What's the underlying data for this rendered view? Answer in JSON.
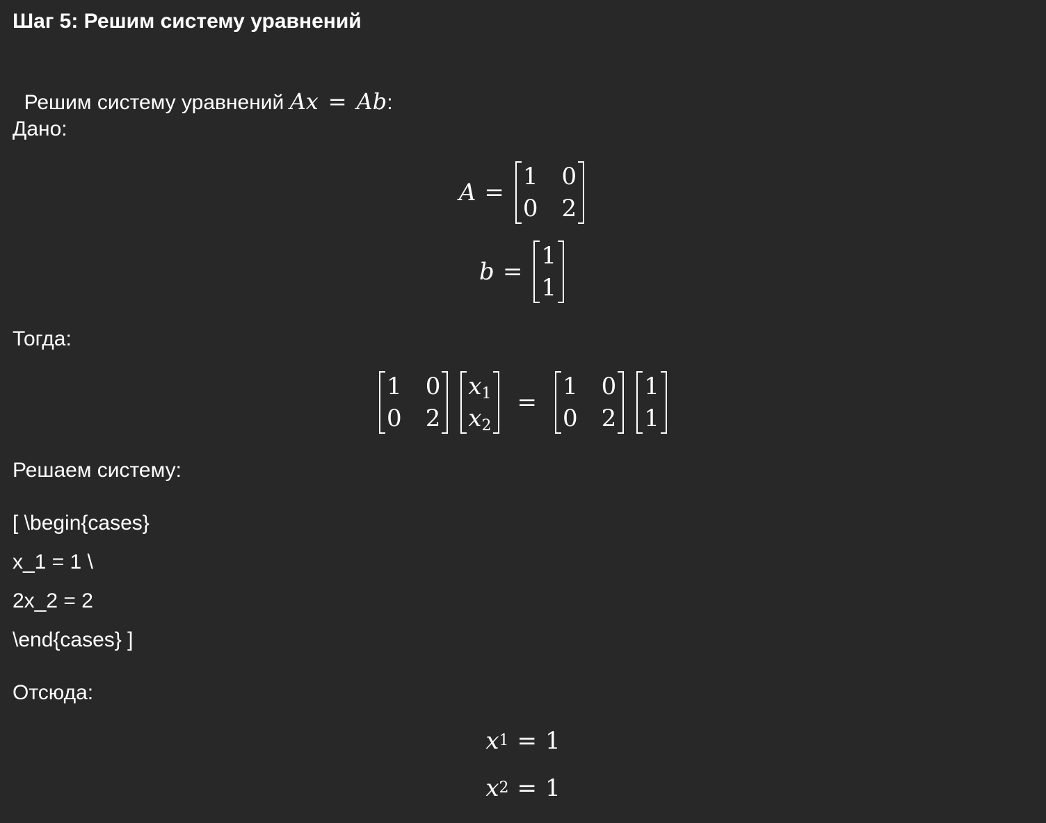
{
  "heading": "Шаг 5: Решим систему уравнений",
  "intro": {
    "text": "Решим систему уравнений ",
    "math_A": "A",
    "math_x": "x",
    "math_eq": "=",
    "math_A2": "A",
    "math_b": "b",
    "suffix": ":"
  },
  "given_label": "Дано:",
  "matrix_A": {
    "name": "A",
    "eq": "=",
    "cells": [
      "1",
      "0",
      "0",
      "2"
    ]
  },
  "vector_b": {
    "name": "b",
    "eq": "=",
    "cells": [
      "1",
      "1"
    ]
  },
  "then_label": "Тогда:",
  "system_eq": {
    "left_matrix": [
      "1",
      "0",
      "0",
      "2"
    ],
    "unknowns": [
      {
        "var": "x",
        "sub": "1"
      },
      {
        "var": "x",
        "sub": "2"
      }
    ],
    "eq": "=",
    "right_matrix": [
      "1",
      "0",
      "0",
      "2"
    ],
    "right_vector": [
      "1",
      "1"
    ]
  },
  "solve_label": "Решаем систему:",
  "raw_lines": [
    "[ \\begin{cases}",
    "x_1 = 1 \\",
    "2x_2 = 2",
    "\\end{cases} ]"
  ],
  "hence_label": "Отсюда:",
  "results": [
    {
      "var": "x",
      "sub": "1",
      "eq": "=",
      "value": "1"
    },
    {
      "var": "x",
      "sub": "2",
      "eq": "=",
      "value": "1"
    }
  ]
}
